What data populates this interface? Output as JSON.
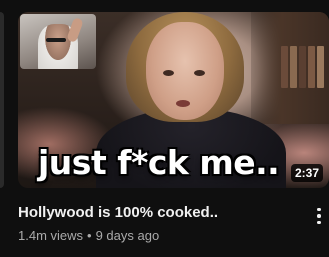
{
  "video": {
    "thumbnail_caption": "just f*ck me..",
    "duration": "2:37",
    "title": "Hollywood is 100% cooked..",
    "views": "1.4m views",
    "separator": "•",
    "age": "9 days ago"
  },
  "icons": {
    "more_actions": "vertical-ellipsis-icon"
  },
  "colors": {
    "background": "#0f0f0f",
    "title_text": "#f1f1f1",
    "meta_text": "#aaaaaa",
    "duration_badge": "#000000"
  }
}
